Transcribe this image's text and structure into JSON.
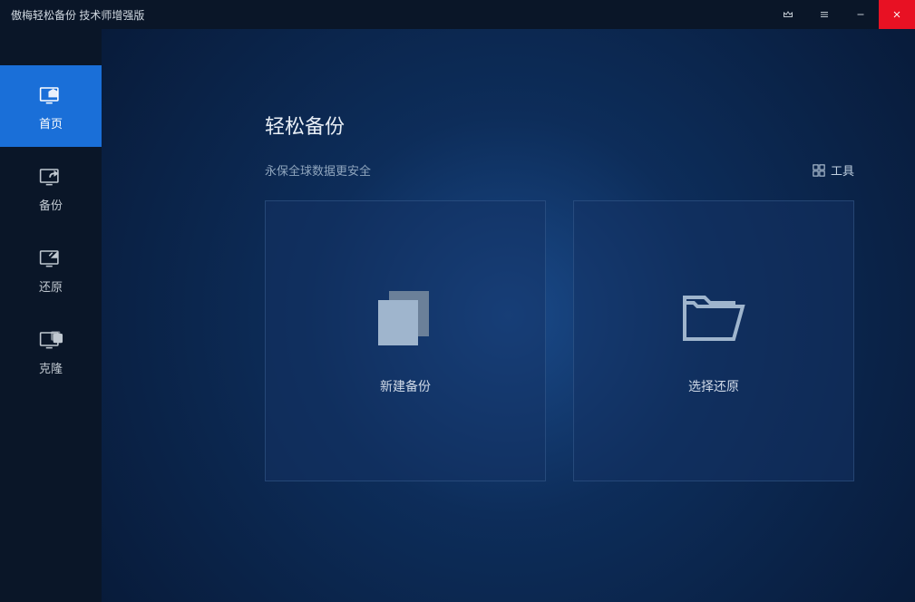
{
  "titlebar": {
    "title": "傲梅轻松备份 技术师增强版"
  },
  "sidebar": {
    "items": [
      {
        "label": "首页"
      },
      {
        "label": "备份"
      },
      {
        "label": "还原"
      },
      {
        "label": "克隆"
      }
    ]
  },
  "main": {
    "title": "轻松备份",
    "subtitle": "永保全球数据更安全",
    "tools_label": "工具"
  },
  "cards": {
    "new_backup": "新建备份",
    "select_restore": "选择还原"
  }
}
